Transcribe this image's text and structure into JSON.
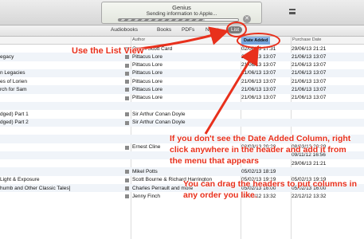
{
  "window": {
    "title": "Genius",
    "status": "Sending information to Apple...",
    "progress": 0.72
  },
  "tabs": [
    {
      "label": "Audiobooks"
    },
    {
      "label": "Books"
    },
    {
      "label": "PDFs"
    },
    {
      "label": "Notes"
    },
    {
      "label": "List",
      "selected": true
    }
  ],
  "columns": {
    "author": "Author",
    "date_added": "Date Added",
    "purchase_date": "Purchase Date"
  },
  "rows": [
    {
      "title": "",
      "author": "Orson Scott Card",
      "date_added": "02/06/13 17:31",
      "purchase_date": "29/06/13 21:21"
    },
    {
      "title": "egacy",
      "author": "Pittacus Lore",
      "date_added": "21/06/13 13:07",
      "purchase_date": "21/06/13 13:07"
    },
    {
      "title": "",
      "author": "Pittacus Lore",
      "date_added": "21/06/13 13:07",
      "purchase_date": "21/06/13 13:07"
    },
    {
      "title": "n Legacies",
      "author": "Pittacus Lore",
      "date_added": "21/06/13 13:07",
      "purchase_date": "21/06/13 13:07"
    },
    {
      "title": "es of Lorien",
      "author": "Pittacus Lore",
      "date_added": "21/06/13 13:07",
      "purchase_date": "21/06/13 13:07"
    },
    {
      "title": "rch for Sam",
      "author": "Pittacus Lore",
      "date_added": "21/06/13 13:07",
      "purchase_date": "21/06/13 13:07"
    },
    {
      "title": "",
      "author": "Pittacus Lore",
      "date_added": "21/06/13 13:07",
      "purchase_date": "21/06/13 13:07"
    },
    {
      "title": "",
      "author": "",
      "date_added": "",
      "purchase_date": ""
    },
    {
      "title": "dged) Part 1",
      "author": "Sir Arthur Conan Doyle",
      "date_added": "",
      "purchase_date": ""
    },
    {
      "title": "dged) Part 2",
      "author": "Sir Arthur Conan Doyle",
      "date_added": "",
      "purchase_date": ""
    },
    {
      "title": "",
      "author": "",
      "date_added": "",
      "purchase_date": ""
    },
    {
      "title": "",
      "author": "",
      "date_added": "",
      "purchase_date": ""
    },
    {
      "title": "",
      "author": "Ernest Cline",
      "date_added": "08/03/13 20:29",
      "purchase_date": "08/03/13 20:29"
    },
    {
      "title": "",
      "author": "",
      "date_added": "",
      "purchase_date": "09/11/12 16:56"
    },
    {
      "title": "",
      "author": "",
      "date_added": "",
      "purchase_date": "29/06/13 21:21"
    },
    {
      "title": "",
      "author": "Mikel Potts",
      "date_added": "05/02/13 18:19",
      "purchase_date": ""
    },
    {
      "title": "Light & Exposure",
      "author": "Scott Bourne & Richard Harrington",
      "date_added": "05/02/13 19:19",
      "purchase_date": "05/02/13 19:19"
    },
    {
      "title": "humb and Other Classic Tales]",
      "author": "Charles Perrault and more",
      "date_added": "05/02/13 16:00",
      "purchase_date": "05/02/13 16:00"
    },
    {
      "title": "",
      "author": "Jenny Finch",
      "date_added": "22/12/12 13:32",
      "purchase_date": "22/12/12 13:32"
    }
  ],
  "annotations": {
    "use_list_view": "Use the List View",
    "date_added_tip": "If you don't see the Date Added Column, right click anywhere in the header and add it from the menu that appears",
    "drag_tip": "You can drag the headers to put columns in any order you like.",
    "color": "#e8301c"
  }
}
